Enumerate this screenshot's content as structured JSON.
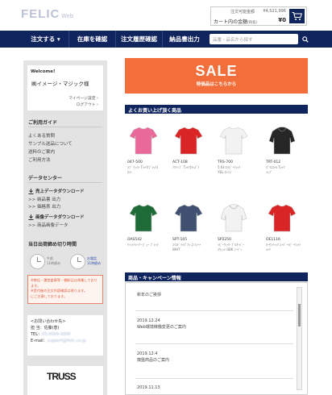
{
  "header": {
    "logo": "FELIC",
    "logo_sub": "Web",
    "cart": {
      "label_top": "注文可能金額",
      "value_top": "¥4,521,996",
      "label_main": "カート内の金額",
      "label_note": "(税抜)",
      "value_main": "¥0"
    }
  },
  "nav": {
    "items": [
      "注文する ▾",
      "在庫を確認",
      "注文履歴確認",
      "納品書出力"
    ],
    "search_placeholder": "品番・品名から探す"
  },
  "sidebar": {
    "welcome": "Welcome!",
    "company": "㈱イメージ・マジック様",
    "mypage_link": "マイページ設定 ›",
    "logout_link": "ログアウト ›",
    "guide_title": "ご利用ガイド",
    "guide_links": [
      "よくある質問",
      "サンプル送品について",
      "送料のご案内",
      "ご利用方法"
    ],
    "data_title": "データセンター",
    "sales_download": "売上データダウンロード",
    "sales_links": [
      ">> 納品書 出力",
      ">> 価格表 出力"
    ],
    "image_download": "画像データダウンロード",
    "image_links": [
      ">> 商品画像データ"
    ],
    "cutoff_title": "当日出荷締め切り時間",
    "clock1_text": [
      "午前",
      "11時締め"
    ],
    "clock2_text": [
      "お電話",
      "11時締め"
    ],
    "notice": "※弊社・運営倉庫等・棚卸日は休業しております。\n※受付後の注文内容確認は承ります。\nにご注意しております。",
    "contact_title": "<お問い合わせ先>",
    "contact_rows": [
      "担 当：佐藤(恵)",
      "TEL：",
      "E-mail："
    ],
    "contact_blurred": [
      "",
      "03-0000-0000",
      "support@felic.co.jp"
    ],
    "banner": "TRUSS"
  },
  "sale": {
    "title": "SALE",
    "subtitle": "特価品はこちらから"
  },
  "products": {
    "title": "よくお買い上げ頂く商品",
    "items": [
      {
        "code": "047-500",
        "name": "ﾗﾌﾞ ｳｪｲﾄ Tｼｬﾂ(ﾌﾞﾗｯｸ)\nｶﾗｰ",
        "color": "#e9699a"
      },
      {
        "code": "ACT-108",
        "name": "ｱｸﾃｨﾌﾞ Tｼｬﾂ(ｷｯｽﾞ)",
        "color": "#d92525"
      },
      {
        "code": "TRS-700",
        "name": "5.6ｵﾝｽﾍﾋﾞｰｳｪｲﾄ\nYEL-ｵﾚﾝｼﾞ",
        "color": "#f2f2f2"
      },
      {
        "code": "TRT-012",
        "name": "ﾎﾟﾘｴｽﾃﾙ Tｼｬﾂ\nﾗｯﾌﾟ",
        "color": "#262626"
      },
      {
        "code": "OAS542",
        "name": "ﾘﾐｯﾄﾄﾚｰﾅｰ ﾋﾞｭｰ ﾌﾞﾗｯｸ",
        "color": "#1f6b37"
      },
      {
        "code": "SPT-105",
        "name": "ｽｲｽﾄﾞﾗｲﾊﾟﾌｫ ｺﾝﾌｫｰﾄ\nWHT",
        "color": "#3f5070"
      },
      {
        "code": "SP2250",
        "name": "ﾍﾋﾞｰｳｪｲﾄ ﾌﾟﾙｵｰﾊﾞｰ\nｽｳｪｯﾄ-SBK ﾌｰﾃﾞｨ",
        "color": "#f2f2f2"
      },
      {
        "code": "OE1116",
        "name": "ｵｰｾﾝﾃｨｯｸ ｽｰﾊﾟｰﾍﾋﾞｰｳｪｲﾄ\nｼｬﾂ",
        "color": "#d92525"
      }
    ]
  },
  "news": {
    "title": "商品・キャンペーン情報",
    "items": [
      {
        "date": "",
        "text": "新年のご挨拶"
      },
      {
        "date": "2019.12.24",
        "text": "Web環境稼働変更のご案内"
      },
      {
        "date": "2019.12.4",
        "text": "廃盤商品のご案内"
      },
      {
        "date": "2019.11.13",
        "text": ""
      }
    ]
  },
  "colors": {
    "navy": "#10245e",
    "sale_orange": "#f26f3b",
    "sidebar_bg": "#e3e3e3",
    "notice_red": "#e05a3a"
  }
}
